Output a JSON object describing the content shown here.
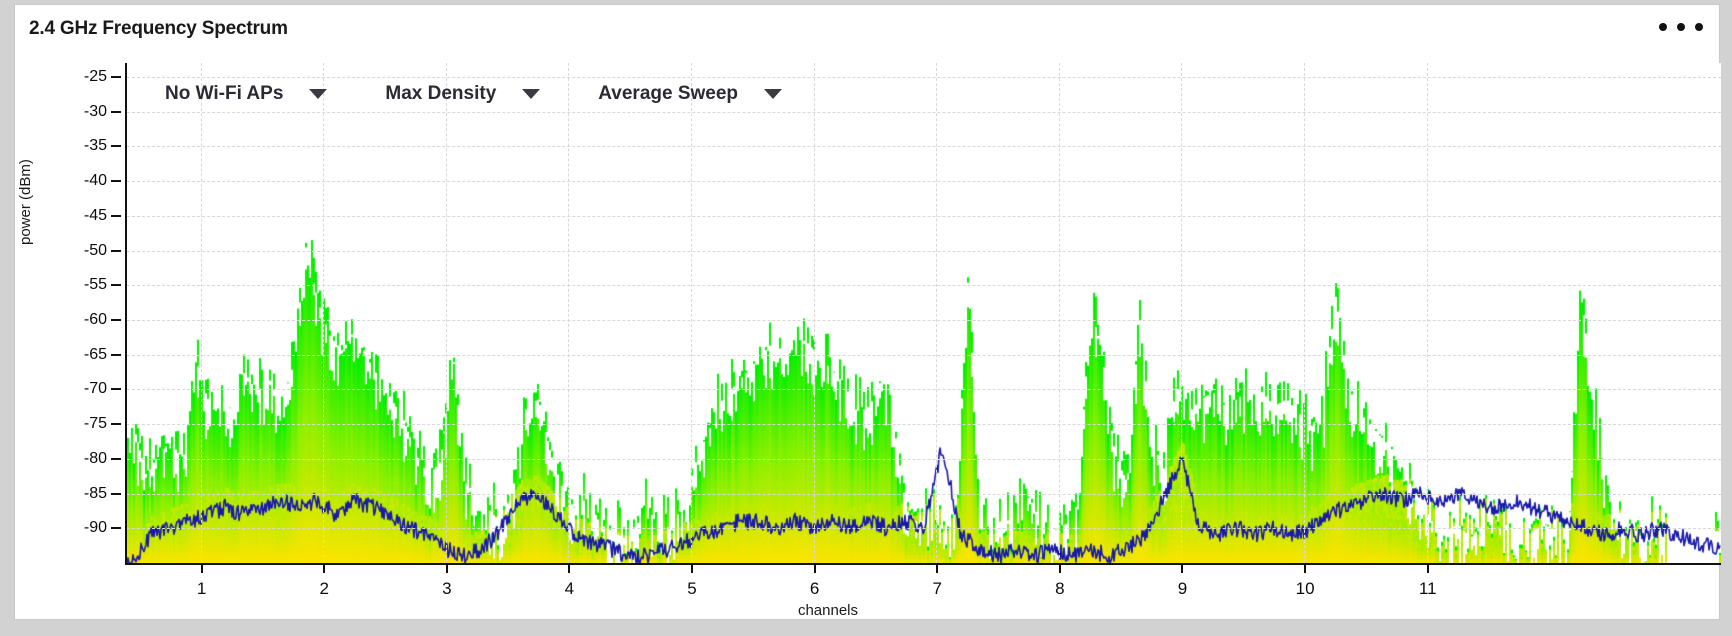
{
  "window": {
    "title": "2.4 GHz Frequency Spectrum",
    "overflow_menu_icon": "three-dots-icon",
    "background": "#d2d2d2",
    "card_background": "#ffffff"
  },
  "controls": [
    {
      "id": "wifi-aps",
      "label": "No Wi-Fi APs",
      "caret_icon": "chevron-down-icon"
    },
    {
      "id": "density",
      "label": "Max Density",
      "caret_icon": "chevron-down-icon"
    },
    {
      "id": "sweep",
      "label": "Average Sweep",
      "caret_icon": "chevron-down-icon"
    }
  ],
  "chart_data": {
    "type": "area",
    "title": "2.4 GHz Frequency Spectrum",
    "xlabel": "channels",
    "ylabel": "power (dBm)",
    "grid": true,
    "legend": "none",
    "xlim": [
      0.4,
      13.4
    ],
    "ylim": [
      -95,
      -23
    ],
    "yticks": [
      -25,
      -30,
      -35,
      -40,
      -45,
      -50,
      -55,
      -60,
      -65,
      -70,
      -75,
      -80,
      -85,
      -90
    ],
    "ytick_labels": [
      "-25",
      "-30",
      "-35",
      "-40",
      "-45",
      "-50",
      "-55",
      "-60",
      "-65",
      "-70",
      "-75",
      "-80",
      "-85",
      "-90"
    ],
    "xticks": [
      1,
      2,
      3,
      4,
      5,
      6,
      7,
      8,
      9,
      10,
      11
    ],
    "xtick_labels": [
      "1",
      "2",
      "3",
      "4",
      "5",
      "6",
      "7",
      "8",
      "9",
      "10",
      "11"
    ],
    "colors": {
      "density_high": "#00ee00",
      "density_mid": "#aaf000",
      "density_low": "#ffe400",
      "sweep_line": "#1a1aaa",
      "axis": "#111111",
      "grid": "#d8d8d8"
    },
    "series": [
      {
        "name": "Max Density",
        "type": "density-histogram",
        "unit": "dBm",
        "note": "per-frequency-bin max hold envelope, colour-coded by hit density (green = sparse/max, yellow = dense/common)",
        "x": [
          0.45,
          0.55,
          0.65,
          0.75,
          0.85,
          0.95,
          1.05,
          1.15,
          1.25,
          1.35,
          1.45,
          1.55,
          1.65,
          1.75,
          1.85,
          1.95,
          2.05,
          2.15,
          2.25,
          2.35,
          2.45,
          2.55,
          2.65,
          2.75,
          2.85,
          2.95,
          3.05,
          3.15,
          3.25,
          3.35,
          3.45,
          3.55,
          3.65,
          3.75,
          3.85,
          3.95,
          4.05,
          4.15,
          4.25,
          4.35,
          4.45,
          4.55,
          4.65,
          4.75,
          4.85,
          4.95,
          5.05,
          5.15,
          5.25,
          5.35,
          5.45,
          5.55,
          5.65,
          5.75,
          5.85,
          5.95,
          6.05,
          6.15,
          6.25,
          6.35,
          6.45,
          6.55,
          6.65,
          6.75,
          6.85,
          6.95,
          7.05,
          7.15,
          7.25,
          7.35,
          7.45,
          7.55,
          7.65,
          7.75,
          7.85,
          7.95,
          8.05,
          8.15,
          8.25,
          8.35,
          8.45,
          8.55,
          8.65,
          8.75,
          8.85,
          8.95,
          9.05,
          9.15,
          9.25,
          9.35,
          9.45,
          9.55,
          9.65,
          9.75,
          9.85,
          9.95,
          10.05,
          10.15,
          10.25,
          10.35,
          10.45,
          10.55,
          10.65,
          10.75,
          10.85,
          10.95,
          11.05,
          11.15,
          11.25,
          11.35,
          11.45,
          11.55,
          11.65,
          11.75,
          11.85,
          11.95,
          12.05,
          12.15,
          12.25,
          12.35,
          12.45,
          12.55,
          12.65,
          12.75,
          12.85,
          12.95,
          13.05,
          13.15,
          13.25,
          13.35
        ],
        "max_hold": [
          -76,
          -83,
          -80,
          -78,
          -81,
          -66,
          -72,
          -70,
          -74,
          -68,
          -71,
          -69,
          -73,
          -67,
          -50,
          -58,
          -63,
          -65,
          -62,
          -66,
          -69,
          -72,
          -75,
          -80,
          -83,
          -81,
          -65,
          -84,
          -86,
          -88,
          -90,
          -84,
          -73,
          -72,
          -80,
          -85,
          -88,
          -86,
          -90,
          -91,
          -92,
          -90,
          -88,
          -91,
          -90,
          -86,
          -80,
          -76,
          -72,
          -70,
          -68,
          -66,
          -64,
          -65,
          -63,
          -64,
          -66,
          -68,
          -70,
          -74,
          -73,
          -69,
          -76,
          -88,
          -90,
          -88,
          -91,
          -90,
          -55,
          -86,
          -89,
          -90,
          -88,
          -86,
          -90,
          -91,
          -90,
          -87,
          -58,
          -66,
          -80,
          -84,
          -60,
          -78,
          -82,
          -70,
          -74,
          -72,
          -71,
          -73,
          -72,
          -70,
          -71,
          -73,
          -72,
          -74,
          -76,
          -73,
          -57,
          -70,
          -74,
          -76,
          -78,
          -80,
          -84,
          -87,
          -90,
          -91,
          -90,
          -92,
          -90,
          -91,
          -90,
          -92,
          -91,
          -90,
          -91,
          -92,
          -56,
          -72,
          -84,
          -88,
          -90,
          -92,
          -90,
          -91
        ]
      },
      {
        "name": "Average Sweep",
        "type": "line",
        "unit": "dBm",
        "color": "#1a1aaa",
        "x": [
          0.45,
          0.6,
          0.75,
          0.9,
          1.05,
          1.2,
          1.35,
          1.5,
          1.65,
          1.8,
          1.95,
          2.1,
          2.25,
          2.4,
          2.55,
          2.7,
          2.85,
          3.0,
          3.15,
          3.3,
          3.45,
          3.6,
          3.75,
          3.9,
          4.05,
          4.2,
          4.35,
          4.5,
          4.65,
          4.8,
          4.95,
          5.1,
          5.25,
          5.4,
          5.55,
          5.7,
          5.85,
          6.0,
          6.15,
          6.3,
          6.45,
          6.6,
          6.75,
          6.9,
          7.05,
          7.2,
          7.35,
          7.5,
          7.65,
          7.8,
          7.95,
          8.1,
          8.25,
          8.4,
          8.55,
          8.7,
          8.85,
          9.0,
          9.15,
          9.3,
          9.45,
          9.6,
          9.75,
          9.9,
          10.05,
          10.2,
          10.35,
          10.5,
          10.65,
          10.8,
          10.95,
          11.1,
          11.25,
          11.4,
          11.55,
          11.7,
          11.85,
          12.0,
          12.15,
          12.3,
          12.45,
          12.6,
          12.75,
          12.9,
          13.05,
          13.2,
          13.35
        ],
        "values": [
          -95,
          -91,
          -90,
          -89,
          -88,
          -87,
          -88,
          -87,
          -86,
          -87,
          -86,
          -88,
          -86,
          -87,
          -88,
          -90,
          -91,
          -93,
          -94,
          -93,
          -90,
          -86,
          -85,
          -88,
          -91,
          -92,
          -93,
          -94,
          -94,
          -93,
          -92,
          -91,
          -90,
          -89,
          -89,
          -90,
          -89,
          -90,
          -89,
          -90,
          -89,
          -90,
          -89,
          -90,
          -78,
          -91,
          -93,
          -94,
          -93,
          -94,
          -93,
          -94,
          -93,
          -94,
          -93,
          -91,
          -86,
          -80,
          -90,
          -91,
          -90,
          -91,
          -90,
          -91,
          -90,
          -88,
          -87,
          -86,
          -85,
          -86,
          -85,
          -86,
          -85,
          -86,
          -87,
          -86,
          -87,
          -88,
          -89,
          -90,
          -91,
          -90,
          -91,
          -90,
          -91,
          -92,
          -93
        ]
      }
    ]
  }
}
